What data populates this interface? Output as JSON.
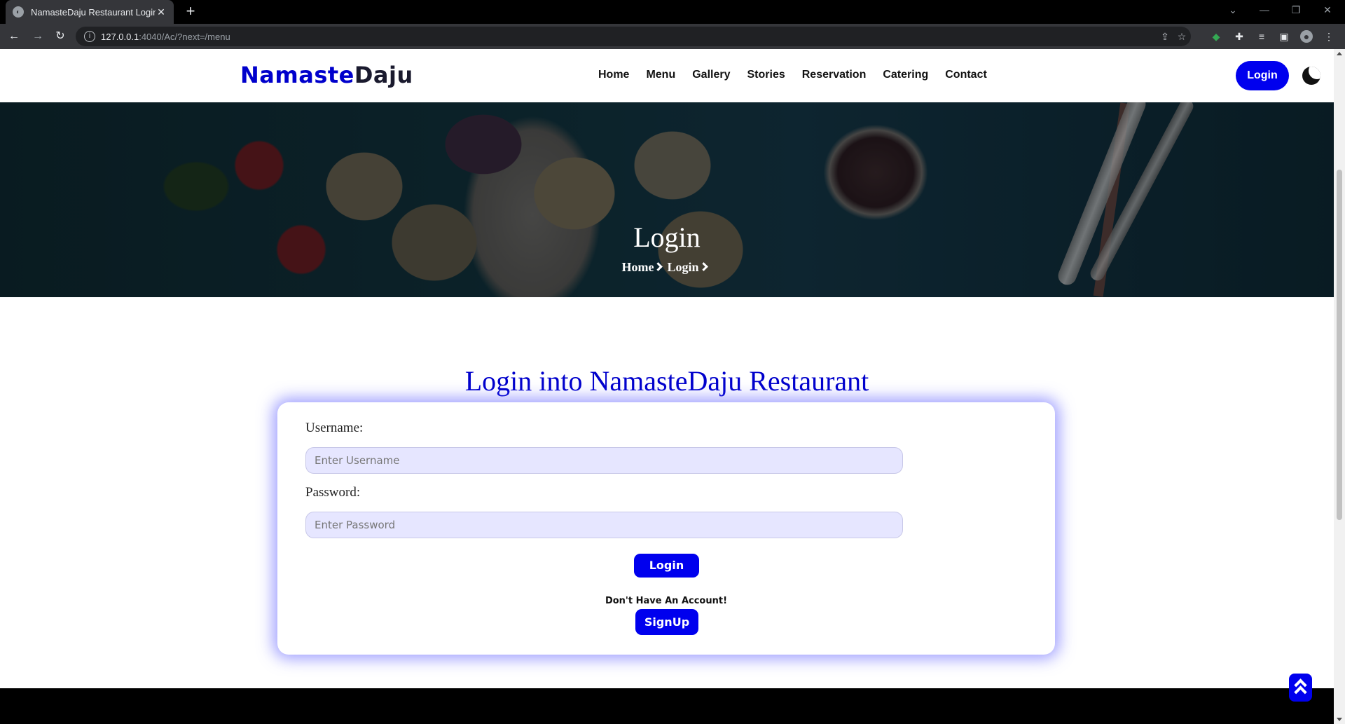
{
  "browser": {
    "tab_title": "NamasteDaju Restaurant Login",
    "url_host": "127.0.0.1",
    "url_path": ":4040/Ac/?next=/menu"
  },
  "header": {
    "logo_part1": "Namaste",
    "logo_part2": "Daju",
    "nav": [
      "Home",
      "Menu",
      "Gallery",
      "Stories",
      "Reservation",
      "Catering",
      "Contact"
    ],
    "login_label": "Login"
  },
  "hero": {
    "title": "Login",
    "breadcrumb": [
      "Home",
      "Login"
    ]
  },
  "login": {
    "heading": "Login into NamasteDaju Restaurant",
    "username_label": "Username:",
    "username_placeholder": "Enter Username",
    "password_label": "Password:",
    "password_placeholder": "Enter Password",
    "submit_label": "Login",
    "no_account_text": "Don't Have An Account!",
    "signup_label": "SignUp"
  },
  "colors": {
    "brand": "#0000ee",
    "heading": "#0000cc",
    "input_bg": "#e6e6ff"
  }
}
